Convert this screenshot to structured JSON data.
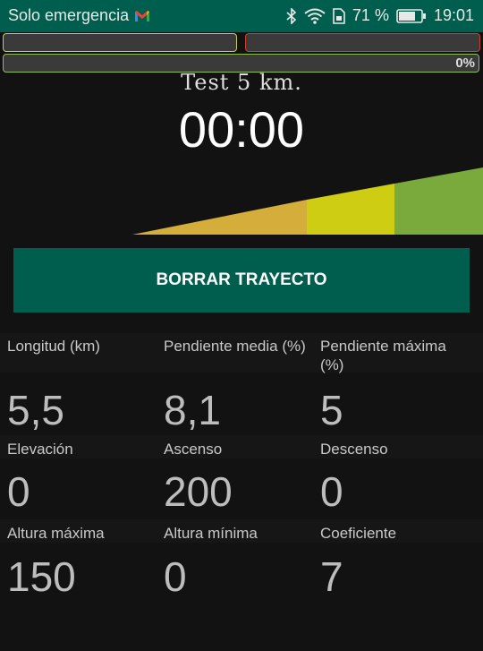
{
  "status_bar": {
    "carrier": "Solo emergencia",
    "battery_text": "71 %",
    "time": "19:01"
  },
  "progress": {
    "bottom_bar_label": "0%"
  },
  "route": {
    "name": "Test 5 km.",
    "timer": "00:00"
  },
  "elevation_profile": {
    "segments": [
      {
        "color": "#d4ad3a"
      },
      {
        "color": "#cfcc14"
      },
      {
        "color": "#7aaa3c"
      }
    ]
  },
  "actions": {
    "clear_route_label": "BORRAR TRAYECTO"
  },
  "stats": [
    {
      "label": "Longitud (km)",
      "value": "5,5"
    },
    {
      "label": "Pendiente media (%)",
      "value": "8,1"
    },
    {
      "label": "Pendiente máxima (%)",
      "value": "5"
    },
    {
      "label": "Elevación",
      "value": "0"
    },
    {
      "label": "Ascenso",
      "value": "200"
    },
    {
      "label": "Descenso",
      "value": "0"
    },
    {
      "label": "Altura máxima",
      "value": "150"
    },
    {
      "label": "Altura mínima",
      "value": "0"
    },
    {
      "label": "Coeficiente",
      "value": "7"
    }
  ],
  "colors": {
    "primary": "#005e4f",
    "background": "#121212"
  }
}
